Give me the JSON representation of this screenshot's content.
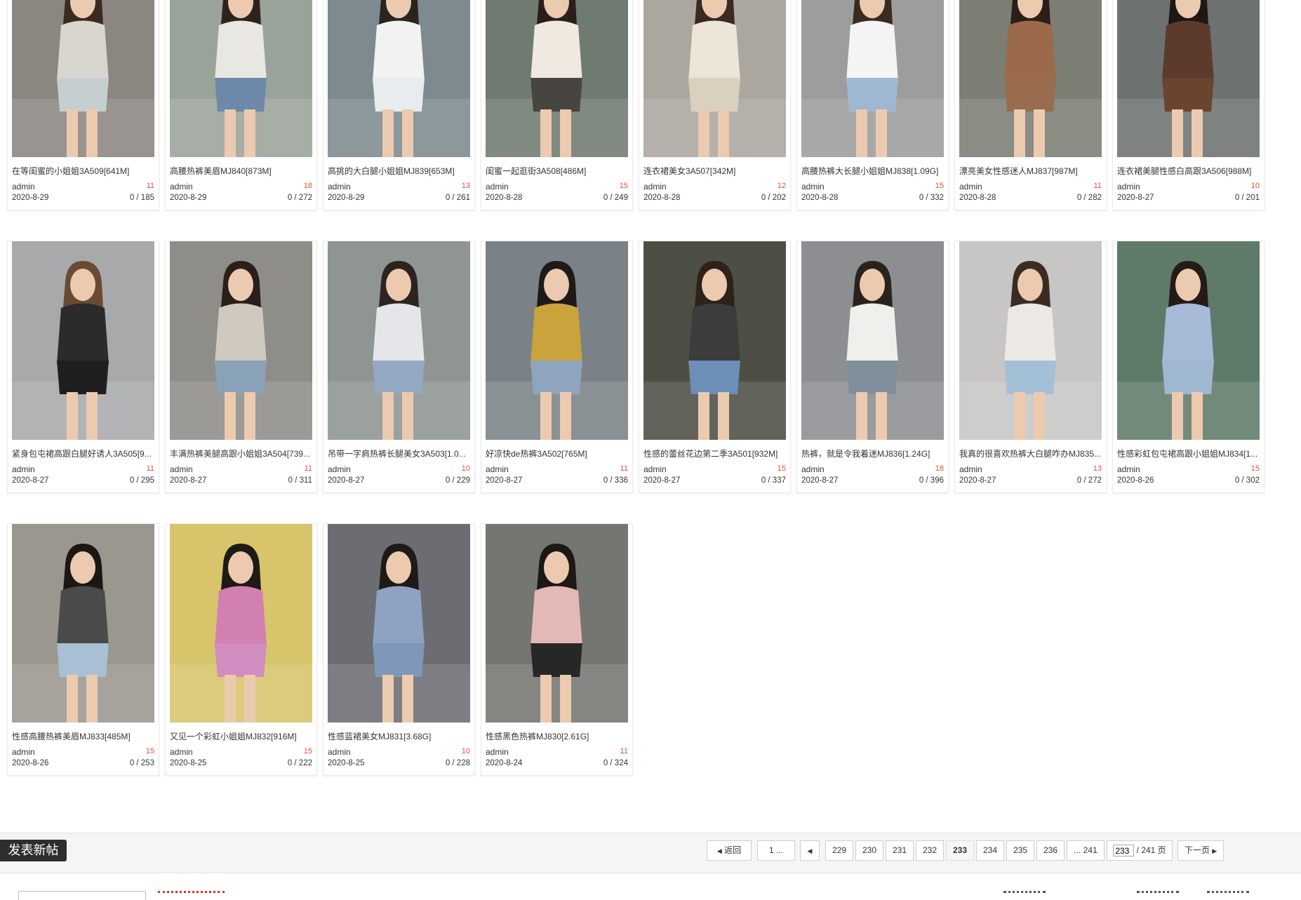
{
  "posts": [
    {
      "title": "在等闺蜜的小姐姐3A509[641M]",
      "author": "admin",
      "replies": "11",
      "date": "2020-8-29",
      "views": "0 / 185"
    },
    {
      "title": "高腰热裤美眉MJ840[873M]",
      "author": "admin",
      "replies": "18",
      "date": "2020-8-29",
      "views": "0 / 272"
    },
    {
      "title": "高挑的大白腿小姐姐MJ839[653M]",
      "author": "admin",
      "replies": "13",
      "date": "2020-8-29",
      "views": "0 / 261"
    },
    {
      "title": "闺蜜一起逛街3A508[486M]",
      "author": "admin",
      "replies": "15",
      "date": "2020-8-28",
      "views": "0 / 249"
    },
    {
      "title": "连衣裙美女3A507[342M]",
      "author": "admin",
      "replies": "12",
      "date": "2020-8-28",
      "views": "0 / 202"
    },
    {
      "title": "高腰热裤大长腿小姐姐MJ838[1.09G]",
      "author": "admin",
      "replies": "15",
      "date": "2020-8-28",
      "views": "0 / 332"
    },
    {
      "title": "漂亮美女性感迷人MJ837[987M]",
      "author": "admin",
      "replies": "11",
      "date": "2020-8-28",
      "views": "0 / 282"
    },
    {
      "title": "连衣裙美腿性感白高跟3A506[988M]",
      "author": "admin",
      "replies": "10",
      "date": "2020-8-27",
      "views": "0 / 201"
    },
    {
      "title": "紧身包屯裙高跟白腿好诱人3A505[9...",
      "author": "admin",
      "replies": "11",
      "date": "2020-8-27",
      "views": "0 / 295"
    },
    {
      "title": "丰满热裤美腿高跟小姐姐3A504[739...",
      "author": "admin",
      "replies": "11",
      "date": "2020-8-27",
      "views": "0 / 311"
    },
    {
      "title": "吊带一字肩热裤长腿美女3A503[1.0...",
      "author": "admin",
      "replies": "10",
      "date": "2020-8-27",
      "views": "0 / 229"
    },
    {
      "title": "好凉快de热裤3A502[765M]",
      "author": "admin",
      "replies": "11",
      "date": "2020-8-27",
      "views": "0 / 336"
    },
    {
      "title": "性感的蕾丝花边第二季3A501[932M]",
      "author": "admin",
      "replies": "15",
      "date": "2020-8-27",
      "views": "0 / 337"
    },
    {
      "title": "热裤，就是令我着迷MJ836[1.24G]",
      "author": "admin",
      "replies": "18",
      "date": "2020-8-27",
      "views": "0 / 396"
    },
    {
      "title": "我真的很喜欢热裤大白腿咋办MJ835...",
      "author": "admin",
      "replies": "13",
      "date": "2020-8-27",
      "views": "0 / 272"
    },
    {
      "title": "性感彩虹包屯裙高跟小姐姐MJ834[1...",
      "author": "admin",
      "replies": "15",
      "date": "2020-8-26",
      "views": "0 / 302"
    },
    {
      "title": "性感高腰热裤美眉MJ833[485M]",
      "author": "admin",
      "replies": "15",
      "date": "2020-8-26",
      "views": "0 / 253"
    },
    {
      "title": "又见一个彩虹小姐姐MJ832[916M]",
      "author": "admin",
      "replies": "15",
      "date": "2020-8-25",
      "views": "0 / 222"
    },
    {
      "title": "性感蓝裙美女MJ831[3.68G]",
      "author": "admin",
      "replies": "10",
      "date": "2020-8-25",
      "views": "0 / 228"
    },
    {
      "title": "性感黑色热裤MJ830[2.61G]",
      "author": "admin",
      "replies": "11",
      "date": "2020-8-24",
      "views": "0 / 324"
    }
  ],
  "thumb_colors": [
    {
      "bg": "#8b8680",
      "top": "#d9d6cf",
      "dress": "#c6cfcf",
      "hair": "#3a2a22"
    },
    {
      "bg": "#9aa39a",
      "top": "#e9e7e2",
      "dress": "#6e88aa",
      "hair": "#2e231c"
    },
    {
      "bg": "#7d8a8f",
      "top": "#f2f2f2",
      "dress": "#e7ecef",
      "hair": "#2b2320"
    },
    {
      "bg": "#6f7a70",
      "top": "#efe9e0",
      "dress": "#46453f",
      "hair": "#2a1e18"
    },
    {
      "bg": "#aba79f",
      "top": "#ece5d8",
      "dress": "#d9d0c0",
      "hair": "#3b2a1f"
    },
    {
      "bg": "#9d9d9e",
      "top": "#f4f4f4",
      "dress": "#9fb8d2",
      "hair": "#3a2a20"
    },
    {
      "bg": "#7c7d73",
      "top": "#9b6a4b",
      "dress": "#9a6c4e",
      "hair": "#2b1f19"
    },
    {
      "bg": "#6d7170",
      "top": "#5c3a2c",
      "dress": "#6b4430",
      "hair": "#1e1713"
    },
    {
      "bg": "#a8a9aa",
      "top": "#2b2b2b",
      "dress": "#1f1f1f",
      "hair": "#6a4a33"
    },
    {
      "bg": "#8e8d88",
      "top": "#cfc9c0",
      "dress": "#8aa2b7",
      "hair": "#2a1f1b"
    },
    {
      "bg": "#8e9592",
      "top": "#e4e6ea",
      "dress": "#93a9c2",
      "hair": "#2d2420"
    },
    {
      "bg": "#7a8287",
      "top": "#c9a33c",
      "dress": "#8ea5bd",
      "hair": "#1e1a18"
    },
    {
      "bg": "#4d4f45",
      "top": "#3c3c3c",
      "dress": "#6b8fb6",
      "hair": "#2d2219"
    },
    {
      "bg": "#8d8e92",
      "top": "#f1efec",
      "dress": "#7f8e9b",
      "hair": "#2a221d"
    },
    {
      "bg": "#c7c6c4",
      "top": "#ece8e4",
      "dress": "#a4c0d6",
      "hair": "#3a2c22"
    },
    {
      "bg": "#5f7a68",
      "top": "#a6bad8",
      "dress": "#9fb7d0",
      "hair": "#241b16"
    },
    {
      "bg": "#9a978f",
      "top": "#4a4a4a",
      "dress": "#a9bfd3",
      "hair": "#1c1714"
    },
    {
      "bg": "#d8c46a",
      "top": "#d27fb1",
      "dress": "#cf8dc0",
      "hair": "#1e1a18"
    },
    {
      "bg": "#6c6d72",
      "top": "#8ea3c2",
      "dress": "#7f97b8",
      "hair": "#1e1a18"
    },
    {
      "bg": "#757571",
      "top": "#e3b8b6",
      "dress": "#272727",
      "hair": "#1d1815"
    }
  ],
  "new_post_label": "发表新帖",
  "pager": {
    "back": "返回",
    "first": "1 ...",
    "prev_icon": "prev-arrow",
    "pages": [
      "229",
      "230",
      "231",
      "232",
      "233",
      "234",
      "235",
      "236"
    ],
    "current": "233",
    "last": "... 241",
    "input_value": "233",
    "total": " / 241 页",
    "next": "下一页"
  }
}
